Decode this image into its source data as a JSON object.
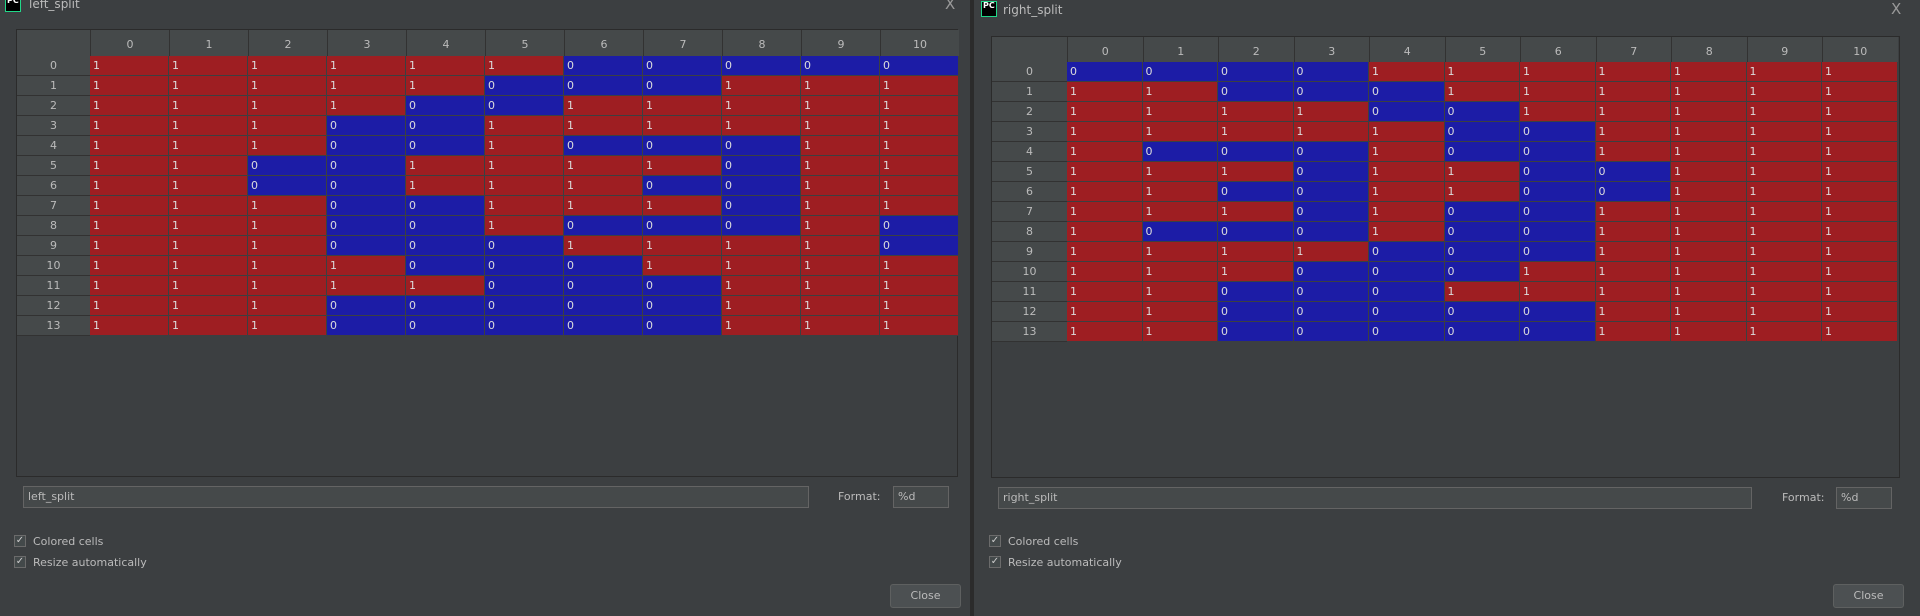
{
  "colors": {
    "one": "#9e1e22",
    "zero": "#1c1ca6"
  },
  "columns": [
    "0",
    "1",
    "2",
    "3",
    "4",
    "5",
    "6",
    "7",
    "8",
    "9",
    "10"
  ],
  "rows": [
    "0",
    "1",
    "2",
    "3",
    "4",
    "5",
    "6",
    "7",
    "8",
    "9",
    "10",
    "11",
    "12",
    "13"
  ],
  "left": {
    "title": "left_split",
    "icon": "pycharm-icon",
    "close_x": "X",
    "name_value": "left_split",
    "format_label": "Format:",
    "format_value": "%d",
    "colored_cells": "Colored cells",
    "resize_auto": "Resize automatically",
    "close_label": "Close",
    "matrix": [
      [
        1,
        1,
        1,
        1,
        1,
        1,
        0,
        0,
        0,
        0,
        0
      ],
      [
        1,
        1,
        1,
        1,
        1,
        0,
        0,
        0,
        1,
        1,
        1
      ],
      [
        1,
        1,
        1,
        1,
        0,
        0,
        1,
        1,
        1,
        1,
        1
      ],
      [
        1,
        1,
        1,
        0,
        0,
        1,
        1,
        1,
        1,
        1,
        1
      ],
      [
        1,
        1,
        1,
        0,
        0,
        1,
        0,
        0,
        0,
        1,
        1
      ],
      [
        1,
        1,
        0,
        0,
        1,
        1,
        1,
        1,
        0,
        1,
        1
      ],
      [
        1,
        1,
        0,
        0,
        1,
        1,
        1,
        0,
        0,
        1,
        1
      ],
      [
        1,
        1,
        1,
        0,
        0,
        1,
        1,
        1,
        0,
        1,
        1
      ],
      [
        1,
        1,
        1,
        0,
        0,
        1,
        0,
        0,
        0,
        1,
        0
      ],
      [
        1,
        1,
        1,
        0,
        0,
        0,
        1,
        1,
        1,
        1,
        0
      ],
      [
        1,
        1,
        1,
        1,
        0,
        0,
        0,
        1,
        1,
        1,
        1
      ],
      [
        1,
        1,
        1,
        1,
        1,
        0,
        0,
        0,
        1,
        1,
        1
      ],
      [
        1,
        1,
        1,
        0,
        0,
        0,
        0,
        0,
        1,
        1,
        1
      ],
      [
        1,
        1,
        1,
        0,
        0,
        0,
        0,
        0,
        1,
        1,
        1
      ]
    ]
  },
  "right": {
    "title": "right_split",
    "icon": "pycharm-icon",
    "close_x": "X",
    "name_value": "right_split",
    "format_label": "Format:",
    "format_value": "%d",
    "colored_cells": "Colored cells",
    "resize_auto": "Resize automatically",
    "close_label": "Close",
    "matrix": [
      [
        0,
        0,
        0,
        0,
        1,
        1,
        1,
        1,
        1,
        1,
        1
      ],
      [
        1,
        1,
        0,
        0,
        0,
        1,
        1,
        1,
        1,
        1,
        1
      ],
      [
        1,
        1,
        1,
        1,
        0,
        0,
        1,
        1,
        1,
        1,
        1
      ],
      [
        1,
        1,
        1,
        1,
        1,
        0,
        0,
        1,
        1,
        1,
        1
      ],
      [
        1,
        0,
        0,
        0,
        1,
        0,
        0,
        1,
        1,
        1,
        1
      ],
      [
        1,
        1,
        1,
        0,
        1,
        1,
        0,
        0,
        1,
        1,
        1
      ],
      [
        1,
        1,
        0,
        0,
        1,
        1,
        0,
        0,
        1,
        1,
        1
      ],
      [
        1,
        1,
        1,
        0,
        1,
        0,
        0,
        1,
        1,
        1,
        1
      ],
      [
        1,
        0,
        0,
        0,
        1,
        0,
        0,
        1,
        1,
        1,
        1
      ],
      [
        1,
        1,
        1,
        1,
        0,
        0,
        0,
        1,
        1,
        1,
        1
      ],
      [
        1,
        1,
        1,
        0,
        0,
        0,
        1,
        1,
        1,
        1,
        1
      ],
      [
        1,
        1,
        0,
        0,
        0,
        1,
        1,
        1,
        1,
        1,
        1
      ],
      [
        1,
        1,
        0,
        0,
        0,
        0,
        0,
        1,
        1,
        1,
        1
      ],
      [
        1,
        1,
        0,
        0,
        0,
        0,
        0,
        1,
        1,
        1,
        1
      ]
    ]
  }
}
